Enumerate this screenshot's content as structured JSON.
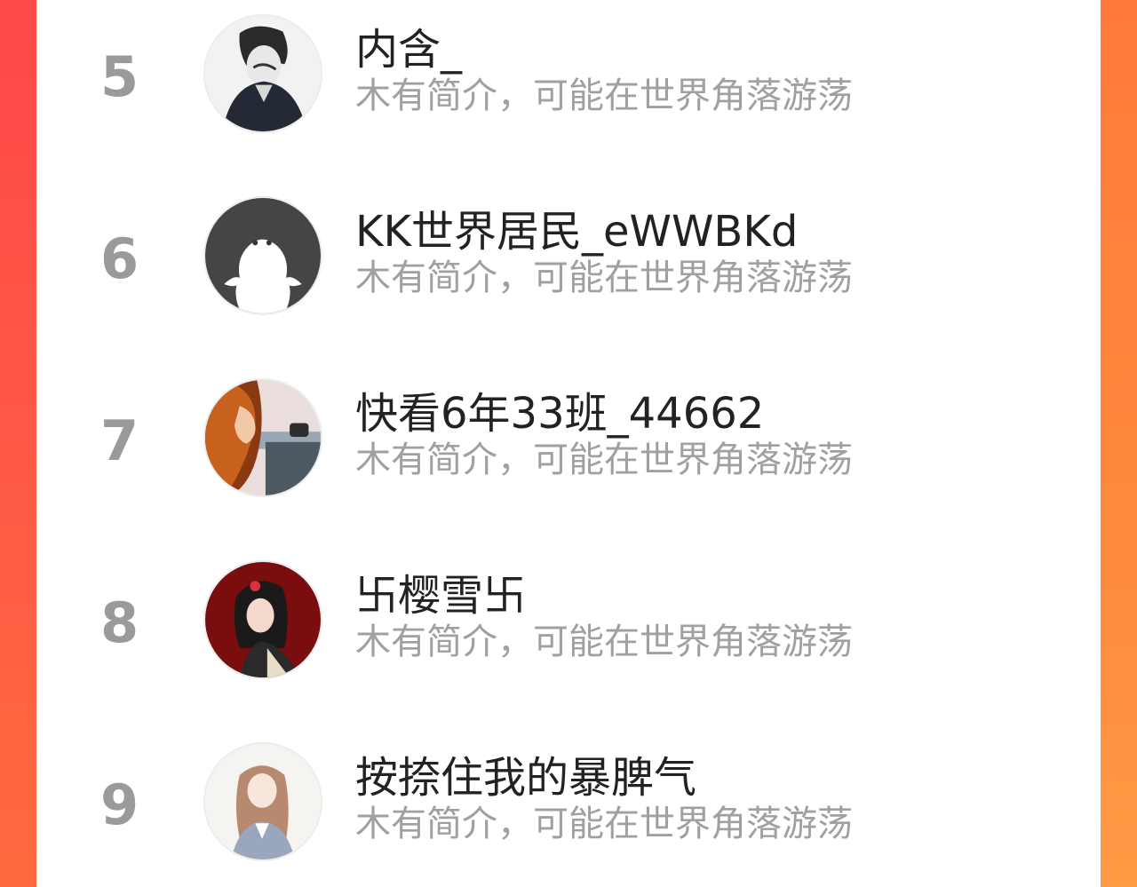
{
  "colors": {
    "left_frame": "#ff4a4a",
    "right_frame": "#ff8a3c",
    "card_bg": "#ffffff",
    "rank_color": "#9a9a9a",
    "name_color": "#222222",
    "bio_color": "#a0a0a0"
  },
  "ranking": [
    {
      "rank": "5",
      "name": "内含_",
      "bio": "木有简介，可能在世界角落游荡",
      "avatar": "avatar-illustration-dark-boy-icon"
    },
    {
      "rank": "6",
      "name": "KK世界居民_eWWBKd",
      "bio": "木有简介，可能在世界角落游荡",
      "avatar": "default-avatar-ghost-icon"
    },
    {
      "rank": "7",
      "name": "快看6年33班_44662",
      "bio": "木有简介，可能在世界角落游荡",
      "avatar": "avatar-illustration-girl-car-icon"
    },
    {
      "rank": "8",
      "name": "卐樱雪卐",
      "bio": "木有简介，可能在世界角落游荡",
      "avatar": "avatar-illustration-girl-red-icon"
    },
    {
      "rank": "9",
      "name": "按捺住我的暴脾气",
      "bio": "木有简介，可能在世界角落游荡",
      "avatar": "avatar-illustration-girl-sketch-icon"
    }
  ]
}
